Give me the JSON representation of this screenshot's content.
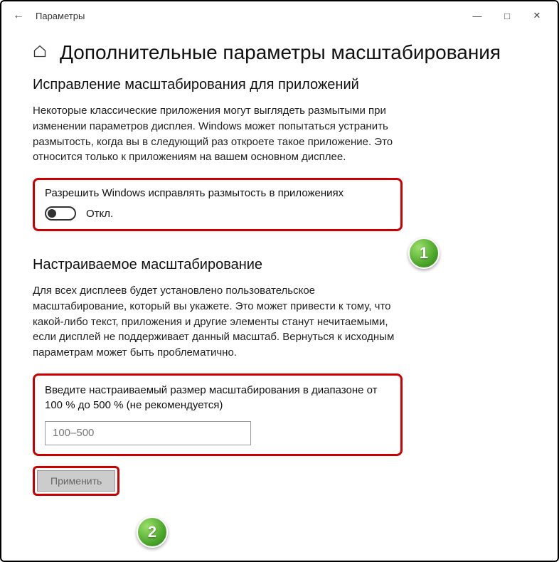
{
  "window": {
    "title": "Параметры"
  },
  "page": {
    "title": "Дополнительные параметры масштабирования",
    "section1": {
      "heading": "Исправление масштабирования для приложений",
      "desc": "Некоторые классические приложения могут выглядеть размытыми при изменении параметров дисплея. Windows может попытаться устранить размытость, когда вы в следующий раз откроете такое приложение. Это относится только к приложениям на вашем основном дисплее.",
      "toggle_label": "Разрешить Windows исправлять размытость в приложениях",
      "toggle_state": "Откл."
    },
    "section2": {
      "heading": "Настраиваемое масштабирование",
      "desc": "Для всех дисплеев будет установлено пользовательское масштабирование, который вы укажете. Это может привести к тому, что какой-либо текст, приложения и другие элементы станут нечитаемыми, если дисплей не поддерживает данный масштаб. Вернуться к исходным параметрам может быть проблематично.",
      "field_label": "Введите настраиваемый размер масштабирования в диапазоне от 100 % до 500 % (не рекомендуется)",
      "placeholder": "100–500",
      "apply": "Применить"
    }
  },
  "annotations": {
    "badge1": "1",
    "badge2": "2"
  }
}
